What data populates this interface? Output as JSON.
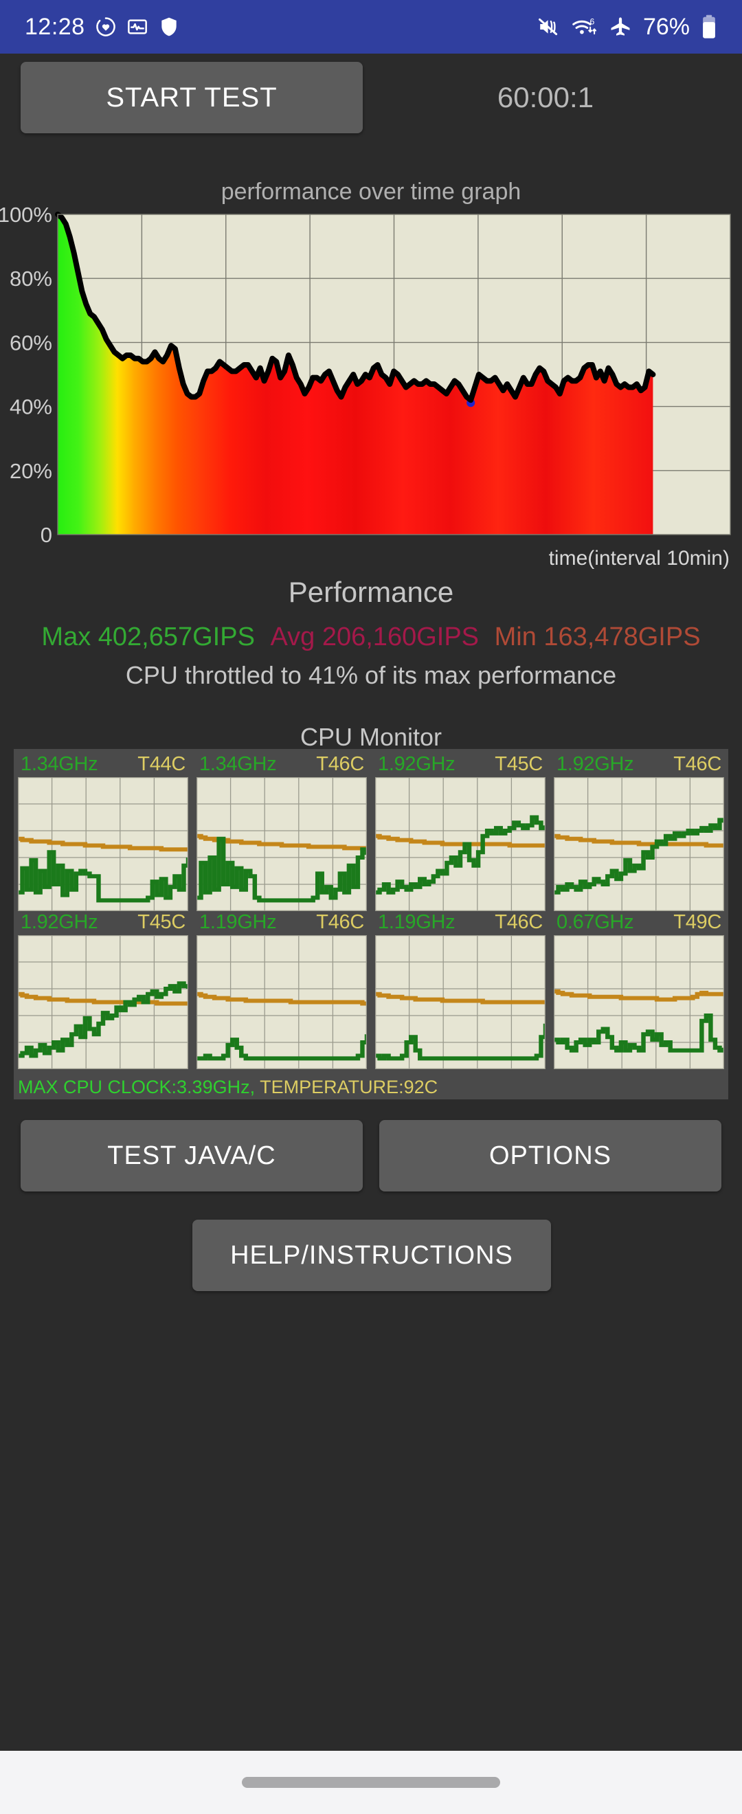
{
  "status_bar": {
    "time": "12:28",
    "battery_percent": "76%",
    "left_icons": [
      "heart-activity-icon",
      "pulse-monitor-icon",
      "shield-icon"
    ],
    "right_icons": [
      "mute-vibrate-icon",
      "wifi-6-icon",
      "airplane-mode-icon"
    ],
    "background_color": "#303f9f"
  },
  "toolbar": {
    "start_test_label": "START TEST",
    "timer": "60:00:1"
  },
  "performance": {
    "section_title": "Performance",
    "max_label": "Max 402,657GIPS",
    "avg_label": "Avg 206,160GIPS",
    "min_label": "Min 163,478GIPS",
    "max_color": "#33aa33",
    "avg_color": "#a4194a",
    "min_color": "#b04a36",
    "throttle_text": "CPU throttled to 41% of its max performance"
  },
  "cpu_monitor": {
    "section_title": "CPU Monitor",
    "freq_color": "#27a827",
    "temp_color": "#ddcd63",
    "cores": [
      {
        "freq": "1.34GHz",
        "temp": "T44C"
      },
      {
        "freq": "1.34GHz",
        "temp": "T46C"
      },
      {
        "freq": "1.92GHz",
        "temp": "T45C"
      },
      {
        "freq": "1.92GHz",
        "temp": "T46C"
      },
      {
        "freq": "1.92GHz",
        "temp": "T45C"
      },
      {
        "freq": "1.19GHz",
        "temp": "T46C"
      },
      {
        "freq": "1.19GHz",
        "temp": "T46C"
      },
      {
        "freq": "0.67GHz",
        "temp": "T49C"
      }
    ],
    "footer_clock": "MAX CPU CLOCK:3.39GHz,",
    "footer_temp": "TEMPERATURE:92C"
  },
  "buttons": {
    "test_java_c": "TEST JAVA/C",
    "options": "OPTIONS",
    "help_instructions": "HELP/INSTRUCTIONS"
  },
  "chart_data": {
    "type": "area",
    "title": "performance over time graph",
    "xlabel": "time(interval 10min)",
    "ylabel": "",
    "ylim": [
      0,
      100
    ],
    "ytick_labels": [
      "100%",
      "80%",
      "60%",
      "40%",
      "20%",
      "0"
    ],
    "ytick_values": [
      100,
      80,
      60,
      40,
      20,
      0
    ],
    "grid": true,
    "plot_background": "#e6e5d3",
    "line_color": "#000000",
    "fill_gradient": [
      "#22ee22",
      "#ffe000",
      "#ff7700",
      "#ff1a1a"
    ],
    "x_data_fraction_filled": 0.885,
    "min_marker_color": "#2222cc",
    "values": [
      100,
      99,
      97,
      93,
      88,
      82,
      76,
      72,
      69,
      68,
      66,
      64,
      61,
      59,
      57,
      56,
      55,
      56,
      56,
      55,
      55,
      54,
      54,
      55,
      57,
      55,
      54,
      56,
      59,
      58,
      52,
      47,
      44,
      43,
      43,
      44,
      48,
      51,
      51,
      52,
      54,
      53,
      52,
      51,
      51,
      52,
      53,
      53,
      51,
      49,
      52,
      48,
      51,
      55,
      54,
      49,
      51,
      56,
      53,
      49,
      47,
      44,
      46,
      49,
      49,
      48,
      50,
      51,
      48,
      45,
      43,
      46,
      48,
      50,
      47,
      48,
      50,
      49,
      52,
      53,
      50,
      49,
      47,
      51,
      50,
      48,
      46,
      47,
      48,
      47,
      47,
      48,
      47,
      47,
      46,
      45,
      44,
      46,
      48,
      47,
      45,
      43,
      42,
      46,
      50,
      49,
      48,
      48,
      49,
      47,
      45,
      47,
      45,
      43,
      46,
      49,
      47,
      47,
      50,
      52,
      51,
      48,
      47,
      46,
      44,
      48,
      49,
      48,
      48,
      49,
      52,
      53,
      53,
      49,
      51,
      48,
      52,
      50,
      47,
      46,
      47,
      46,
      46,
      47,
      45,
      46,
      51,
      50
    ]
  },
  "cpu_core_series": [
    {
      "freq": [
        14,
        32,
        16,
        38,
        14,
        30,
        18,
        44,
        20,
        34,
        12,
        30,
        16,
        28,
        30,
        28,
        26,
        26,
        8,
        8,
        8,
        8,
        8,
        8,
        8,
        8,
        8,
        8,
        8,
        10,
        22,
        12,
        24,
        10,
        18,
        26,
        16,
        34,
        40
      ],
      "temp": [
        54,
        53,
        53,
        52,
        52,
        52,
        52,
        51,
        51,
        51,
        50,
        50,
        50,
        50,
        50,
        49,
        49,
        49,
        49,
        48,
        48,
        48,
        48,
        48,
        48,
        47,
        47,
        47,
        47,
        47,
        47,
        47,
        46,
        46,
        46,
        46,
        46,
        46,
        46
      ]
    },
    {
      "freq": [
        10,
        36,
        14,
        40,
        16,
        54,
        20,
        36,
        18,
        32,
        16,
        30,
        26,
        10,
        8,
        8,
        8,
        8,
        8,
        8,
        8,
        8,
        8,
        8,
        8,
        8,
        10,
        28,
        14,
        18,
        10,
        16,
        28,
        14,
        34,
        18,
        40,
        46,
        42
      ],
      "temp": [
        56,
        55,
        54,
        54,
        53,
        53,
        53,
        52,
        52,
        52,
        51,
        51,
        51,
        51,
        50,
        50,
        50,
        50,
        50,
        49,
        49,
        49,
        49,
        49,
        49,
        48,
        48,
        48,
        48,
        48,
        48,
        48,
        48,
        47,
        47,
        47,
        47,
        47,
        47
      ]
    },
    {
      "freq": [
        14,
        16,
        20,
        14,
        16,
        22,
        18,
        16,
        20,
        18,
        24,
        20,
        22,
        26,
        30,
        28,
        36,
        40,
        34,
        44,
        50,
        38,
        34,
        44,
        56,
        60,
        58,
        62,
        58,
        60,
        62,
        66,
        64,
        62,
        64,
        70,
        66,
        62,
        64
      ],
      "temp": [
        56,
        55,
        55,
        54,
        54,
        53,
        53,
        53,
        52,
        52,
        52,
        51,
        51,
        51,
        51,
        50,
        50,
        50,
        50,
        50,
        50,
        50,
        50,
        50,
        50,
        50,
        50,
        50,
        50,
        50,
        49,
        49,
        49,
        49,
        49,
        49,
        49,
        49,
        49
      ]
    },
    {
      "freq": [
        14,
        18,
        16,
        20,
        18,
        16,
        22,
        18,
        20,
        24,
        22,
        20,
        26,
        30,
        24,
        28,
        38,
        30,
        34,
        32,
        44,
        40,
        48,
        52,
        50,
        56,
        54,
        58,
        56,
        58,
        60,
        58,
        60,
        62,
        60,
        64,
        62,
        68,
        66
      ],
      "temp": [
        56,
        55,
        55,
        54,
        54,
        54,
        53,
        53,
        53,
        52,
        52,
        52,
        52,
        51,
        51,
        51,
        51,
        51,
        51,
        50,
        50,
        50,
        50,
        50,
        50,
        50,
        50,
        50,
        50,
        50,
        50,
        50,
        50,
        50,
        49,
        49,
        49,
        49,
        49
      ]
    },
    {
      "freq": [
        10,
        12,
        16,
        10,
        14,
        18,
        12,
        16,
        20,
        14,
        22,
        18,
        26,
        32,
        24,
        38,
        30,
        26,
        34,
        42,
        38,
        40,
        46,
        44,
        50,
        48,
        52,
        54,
        50,
        56,
        58,
        54,
        56,
        60,
        62,
        58,
        64,
        62,
        60
      ],
      "temp": [
        56,
        55,
        54,
        54,
        53,
        53,
        53,
        52,
        52,
        52,
        52,
        51,
        51,
        51,
        51,
        51,
        51,
        50,
        50,
        50,
        50,
        50,
        50,
        50,
        50,
        50,
        50,
        50,
        50,
        50,
        50,
        49,
        49,
        49,
        49,
        49,
        49,
        49,
        49
      ]
    },
    {
      "freq": [
        8,
        8,
        10,
        8,
        8,
        8,
        10,
        18,
        22,
        16,
        10,
        8,
        8,
        8,
        8,
        8,
        8,
        8,
        8,
        8,
        8,
        8,
        8,
        8,
        8,
        8,
        8,
        8,
        8,
        8,
        8,
        8,
        8,
        8,
        8,
        8,
        10,
        20,
        26
      ],
      "temp": [
        56,
        55,
        54,
        54,
        53,
        53,
        53,
        52,
        52,
        52,
        52,
        51,
        51,
        51,
        51,
        51,
        51,
        51,
        51,
        51,
        51,
        50,
        50,
        50,
        50,
        50,
        50,
        50,
        50,
        50,
        50,
        50,
        50,
        50,
        50,
        50,
        50,
        49,
        49
      ]
    },
    {
      "freq": [
        10,
        8,
        10,
        8,
        8,
        8,
        10,
        20,
        24,
        14,
        8,
        8,
        8,
        8,
        8,
        8,
        8,
        8,
        8,
        8,
        8,
        8,
        8,
        8,
        8,
        8,
        8,
        8,
        8,
        8,
        8,
        8,
        8,
        8,
        8,
        8,
        10,
        24,
        34
      ],
      "temp": [
        56,
        55,
        55,
        54,
        54,
        54,
        53,
        53,
        53,
        52,
        52,
        52,
        52,
        52,
        52,
        51,
        51,
        51,
        51,
        51,
        51,
        51,
        51,
        51,
        50,
        50,
        50,
        50,
        50,
        50,
        50,
        50,
        50,
        50,
        50,
        50,
        50,
        50,
        50
      ]
    },
    {
      "freq": [
        22,
        20,
        22,
        16,
        14,
        20,
        22,
        18,
        22,
        20,
        28,
        30,
        24,
        16,
        14,
        20,
        14,
        18,
        16,
        14,
        26,
        28,
        22,
        26,
        18,
        20,
        14,
        14,
        14,
        14,
        14,
        14,
        14,
        36,
        40,
        22,
        16,
        14,
        16
      ],
      "temp": [
        58,
        57,
        56,
        56,
        55,
        55,
        55,
        55,
        54,
        54,
        54,
        54,
        54,
        54,
        54,
        53,
        53,
        53,
        53,
        53,
        53,
        53,
        53,
        52,
        52,
        52,
        52,
        53,
        53,
        53,
        53,
        54,
        56,
        57,
        56,
        56,
        56,
        56,
        56
      ]
    }
  ]
}
